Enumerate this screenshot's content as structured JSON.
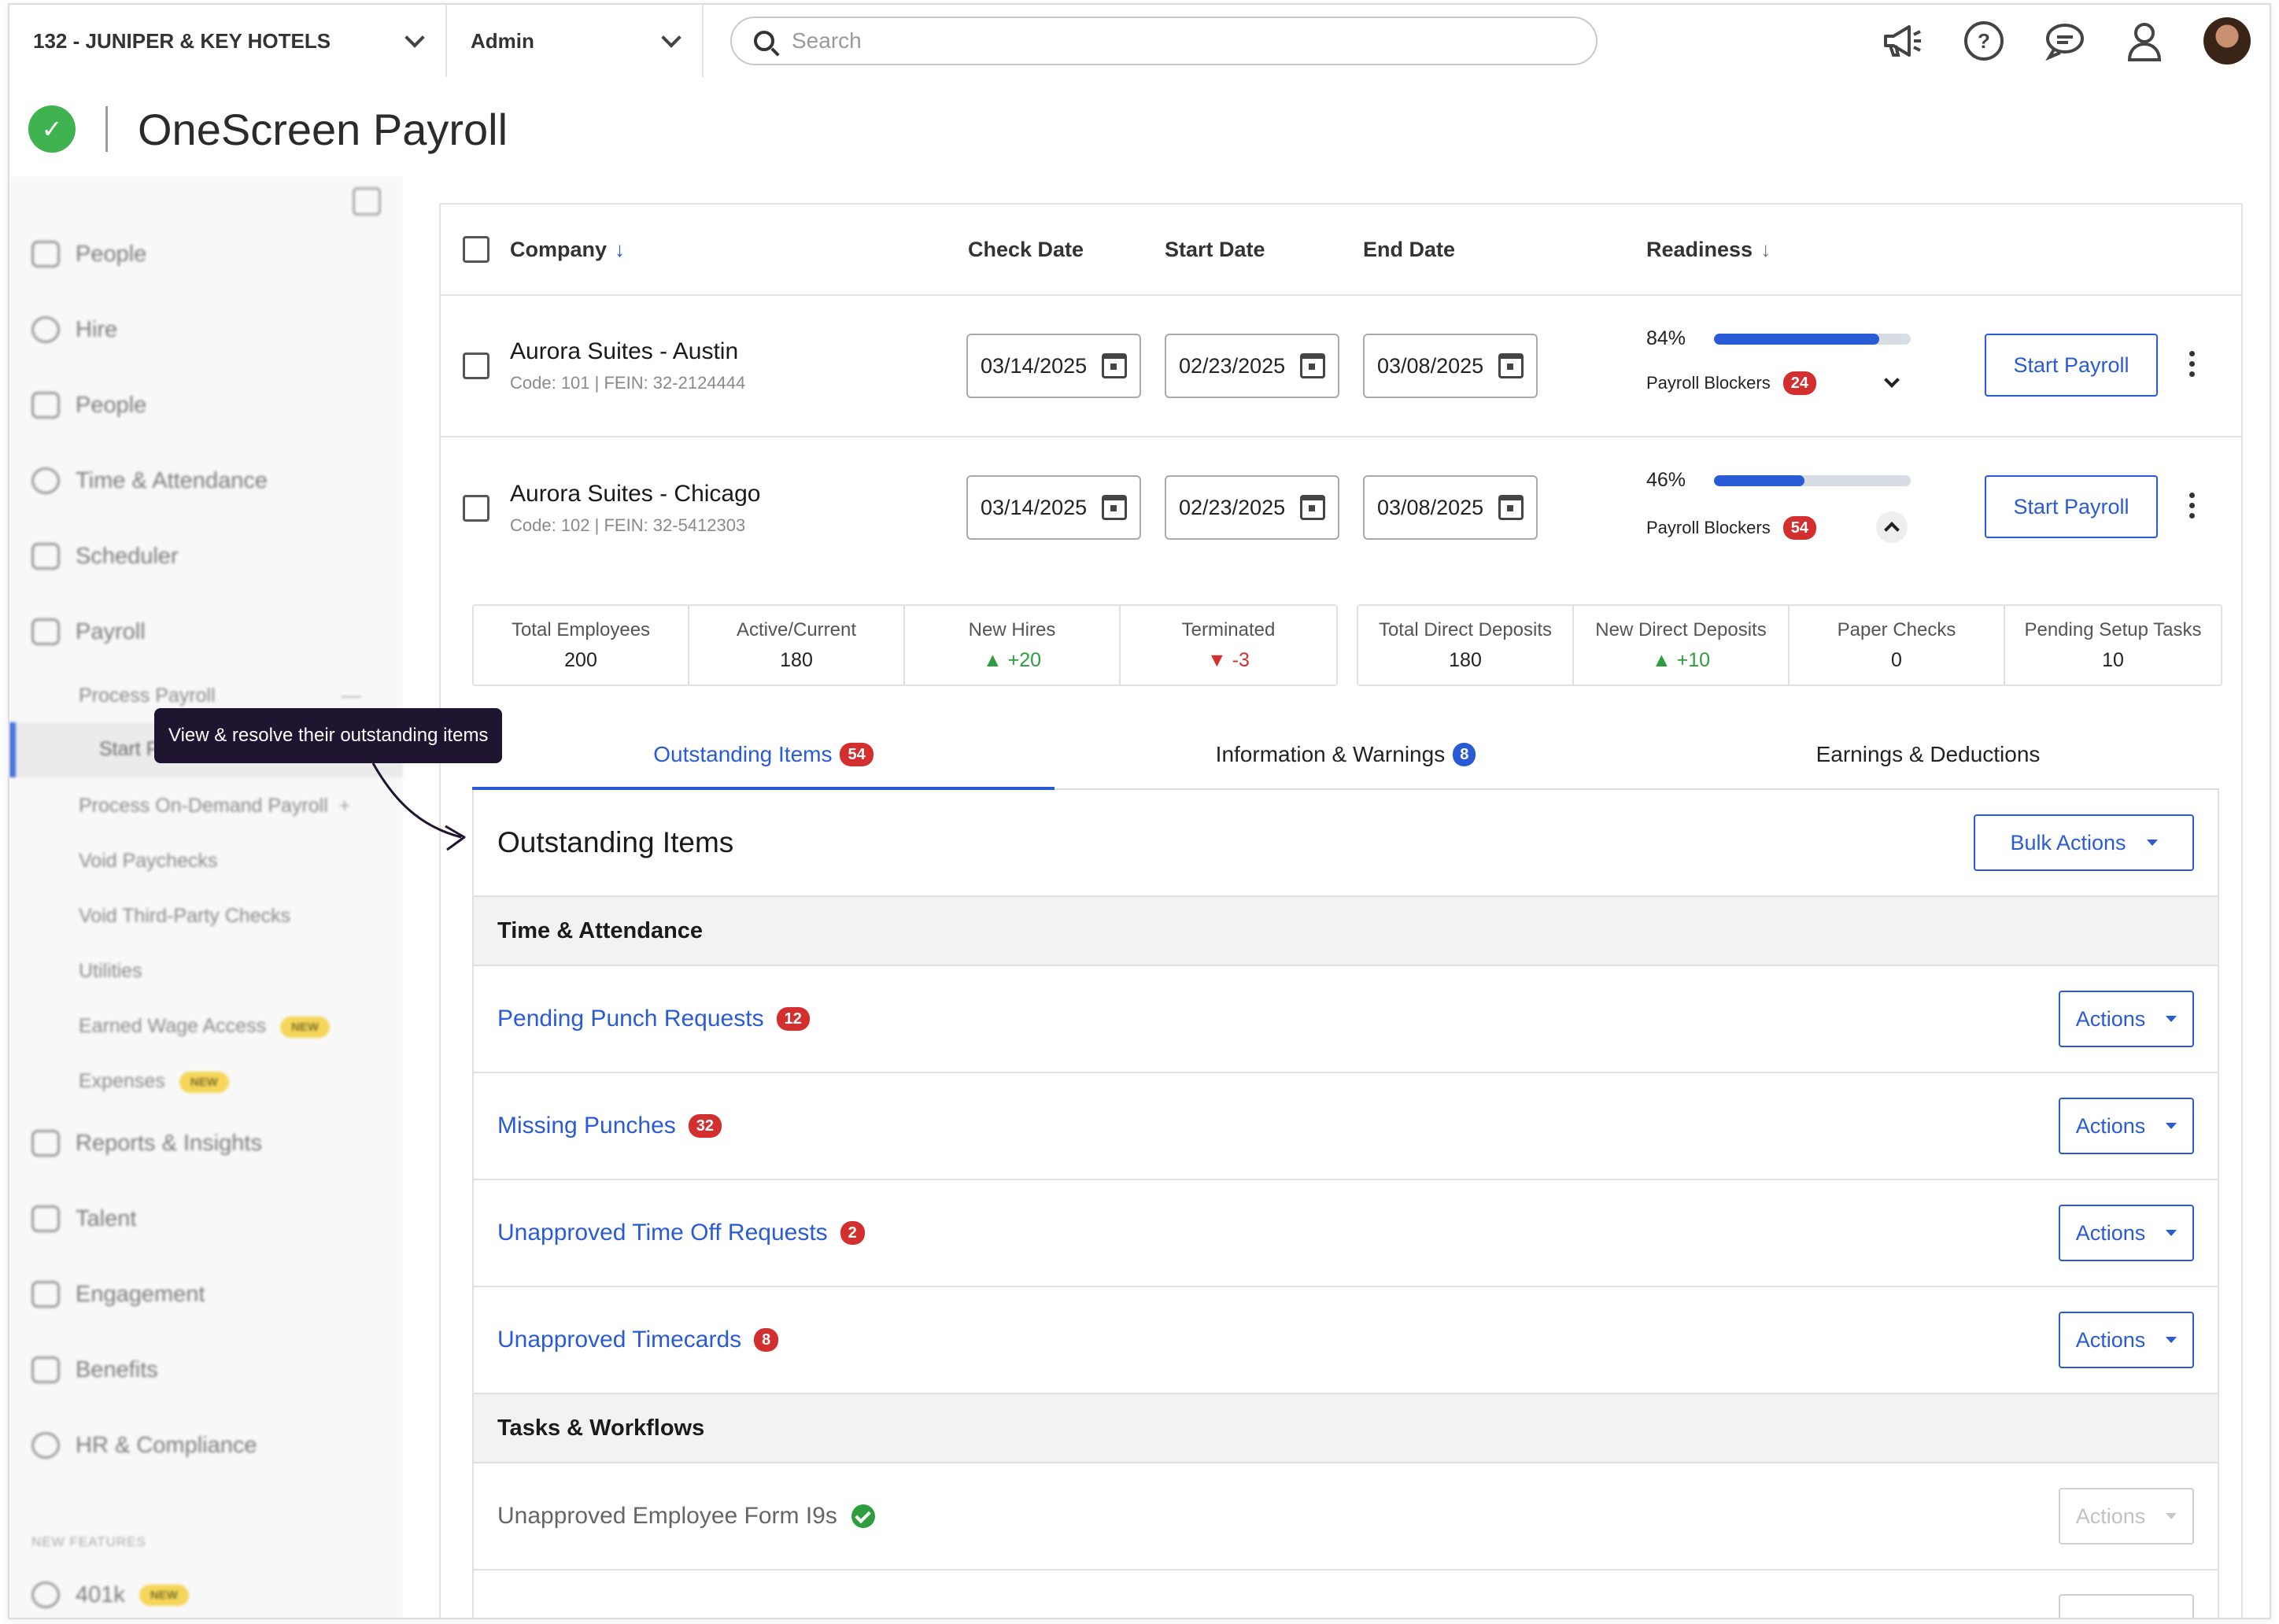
{
  "topbar": {
    "company_selector": "132 - JUNIPER & KEY HOTELS",
    "role_selector": "Admin",
    "search_placeholder": "Search"
  },
  "brand": {
    "title": "OneScreen Payroll"
  },
  "sidebar": {
    "items": [
      {
        "label": "People"
      },
      {
        "label": "Hire"
      },
      {
        "label": "People"
      },
      {
        "label": "Time & Attendance"
      },
      {
        "label": "Scheduler"
      },
      {
        "label": "Payroll"
      }
    ],
    "payroll_sub": [
      {
        "label": "Process Payroll"
      },
      {
        "label": "Start Payroll"
      },
      {
        "label": "Process On-Demand Payroll"
      },
      {
        "label": "Void Paychecks"
      },
      {
        "label": "Void Third-Party Checks"
      },
      {
        "label": "Utilities"
      },
      {
        "label": "Earned Wage Access",
        "tag": "NEW"
      },
      {
        "label": "Expenses",
        "tag": "NEW"
      }
    ],
    "lower_items": [
      {
        "label": "Reports & Insights"
      },
      {
        "label": "Talent"
      },
      {
        "label": "Engagement"
      },
      {
        "label": "Benefits"
      },
      {
        "label": "HR & Compliance"
      }
    ],
    "section_label": "NEW FEATURES",
    "feature_item": {
      "label": "401k",
      "tag": "NEW"
    }
  },
  "table": {
    "headers": {
      "company": "Company",
      "check_date": "Check Date",
      "start_date": "Start Date",
      "end_date": "End Date",
      "readiness": "Readiness"
    },
    "rows": [
      {
        "name": "Aurora Suites - Austin",
        "meta": "Code: 101  |  FEIN: 32-2124444",
        "check_date": "03/14/2025",
        "start_date": "02/23/2025",
        "end_date": "03/08/2025",
        "readiness_label": "84%",
        "readiness_value": 84,
        "blockers_label": "Payroll Blockers",
        "blockers_count": "24",
        "action": "Start Payroll"
      },
      {
        "name": "Aurora Suites - Chicago",
        "meta": "Code: 102  |  FEIN: 32-5412303",
        "check_date": "03/14/2025",
        "start_date": "02/23/2025",
        "end_date": "03/08/2025",
        "readiness_label": "46%",
        "readiness_value": 46,
        "blockers_label": "Payroll Blockers",
        "blockers_count": "54",
        "action": "Start Payroll"
      }
    ]
  },
  "stats_left": [
    {
      "label": "Total Employees",
      "value": "200"
    },
    {
      "label": "Active/Current",
      "value": "180"
    },
    {
      "label": "New Hires",
      "value": "+20",
      "trend": "up"
    },
    {
      "label": "Terminated",
      "value": "-3",
      "trend": "down"
    }
  ],
  "stats_right": [
    {
      "label": "Total Direct Deposits",
      "value": "180"
    },
    {
      "label": "New Direct Deposits",
      "value": "+10",
      "trend": "up"
    },
    {
      "label": "Paper Checks",
      "value": "0"
    },
    {
      "label": "Pending Setup Tasks",
      "value": "10"
    }
  ],
  "tabs": [
    {
      "label": "Outstanding Items",
      "badge": "54"
    },
    {
      "label": "Information & Warnings",
      "badge": "8"
    },
    {
      "label": "Earnings & Deductions"
    }
  ],
  "panel": {
    "title": "Outstanding Items",
    "bulk_label": "Bulk Actions",
    "sections": [
      {
        "title": "Time & Attendance",
        "items": [
          {
            "label": "Pending Punch Requests",
            "count": "12",
            "action": "Actions"
          },
          {
            "label": "Missing Punches",
            "count": "32",
            "action": "Actions"
          },
          {
            "label": "Unapproved Time Off Requests",
            "count": "2",
            "action": "Actions"
          },
          {
            "label": "Unapproved Timecards",
            "count": "8",
            "action": "Actions"
          }
        ]
      },
      {
        "title": "Tasks & Workflows",
        "items": [
          {
            "label": "Unapproved Employee Form I9s",
            "status": "complete",
            "action": "Actions"
          }
        ]
      }
    ]
  },
  "tooltip": "View & resolve their outstanding items",
  "colors": {
    "accent": "#2a5bd7",
    "danger": "#d32f2f",
    "success": "#2e9d3e",
    "brand": "#3fb34f"
  }
}
